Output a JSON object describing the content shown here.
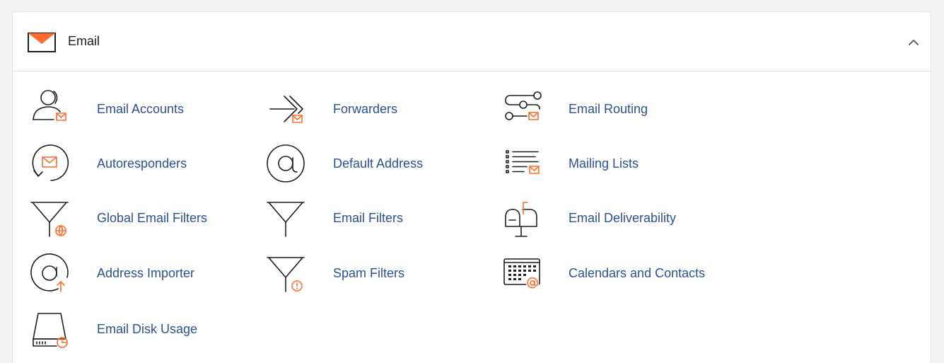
{
  "section": {
    "title": "Email",
    "icon": "envelope-icon",
    "collapse_icon": "chevron-up-icon"
  },
  "items": [
    {
      "label": "Email Accounts",
      "icon": "email-accounts-icon"
    },
    {
      "label": "Forwarders",
      "icon": "forwarders-icon"
    },
    {
      "label": "Email Routing",
      "icon": "email-routing-icon"
    },
    {
      "label": "Autoresponders",
      "icon": "autoresponders-icon"
    },
    {
      "label": "Default Address",
      "icon": "default-address-icon"
    },
    {
      "label": "Mailing Lists",
      "icon": "mailing-lists-icon"
    },
    {
      "label": "Global Email Filters",
      "icon": "global-email-filters-icon"
    },
    {
      "label": "Email Filters",
      "icon": "email-filters-icon"
    },
    {
      "label": "Email Deliverability",
      "icon": "email-deliverability-icon"
    },
    {
      "label": "Address Importer",
      "icon": "address-importer-icon"
    },
    {
      "label": "Spam Filters",
      "icon": "spam-filters-icon"
    },
    {
      "label": "Calendars and Contacts",
      "icon": "calendars-contacts-icon"
    },
    {
      "label": "Email Disk Usage",
      "icon": "email-disk-usage-icon"
    }
  ],
  "colors": {
    "link": "#2d5192",
    "accent": "#ff6c2c",
    "icon_stroke": "#1f1f1f"
  }
}
